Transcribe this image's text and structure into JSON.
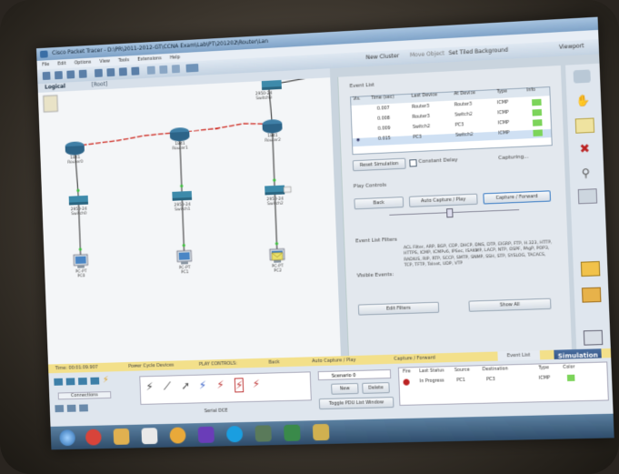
{
  "window": {
    "title": "Cisco Packet Tracer - D:\\PR\\2011-2012-GT\\CCNA Exam\\Lab\\PT\\201202\\Router\\Lan"
  },
  "menu": [
    "File",
    "Edit",
    "Options",
    "View",
    "Tools",
    "Extensions",
    "Help"
  ],
  "toolbar": {
    "new_cluster": "New Cluster",
    "move_object": "Move Object",
    "set_background": "Set Tiled Background",
    "viewport": "Viewport"
  },
  "workspace": {
    "logical_tab": "Logical",
    "root_label": "[Root]"
  },
  "devices": [
    {
      "model": "1841",
      "name": "Router0"
    },
    {
      "model": "1841",
      "name": "Router1"
    },
    {
      "model": "1841",
      "name": "Router2"
    },
    {
      "model": "2950-24",
      "name": "Switch3"
    },
    {
      "model": "2950-24",
      "name": "Switch0"
    },
    {
      "model": "2950-24",
      "name": "Switch1"
    },
    {
      "model": "2950-24",
      "name": "Switch2"
    },
    {
      "model": "PC-PT",
      "name": "PC0"
    },
    {
      "model": "PC-PT",
      "name": "PC1"
    },
    {
      "model": "PC-PT",
      "name": "PC2"
    }
  ],
  "event_list": {
    "title": "Event List",
    "headers": [
      "Vis.",
      "Time (sec)",
      "Last Device",
      "At Device",
      "Type",
      "Info"
    ],
    "rows": [
      {
        "time": "0.007",
        "last": "Router3",
        "at": "Router3",
        "type": "ICMP"
      },
      {
        "time": "0.008",
        "last": "Router3",
        "at": "Switch2",
        "type": "ICMP"
      },
      {
        "time": "0.009",
        "last": "Switch2",
        "at": "PC3",
        "type": "ICMP"
      },
      {
        "time": "0.015",
        "last": "PC3",
        "at": "Switch2",
        "type": "ICMP"
      }
    ],
    "reset_simulation": "Reset Simulation",
    "constant_delay": "Constant Delay",
    "capturing": "Capturing..."
  },
  "play_controls": {
    "title": "Play Controls",
    "back": "Back",
    "auto_capture": "Auto Capture / Play",
    "capture_forward": "Capture / Forward"
  },
  "filters": {
    "title": "Event List Filters",
    "visible_label": "Visible Events:",
    "visible_events": "ACL Filter, ARP, BGP, CDP, DHCP, DNS, DTP, EIGRP, FTP, H.323, HTTP, HTTPS, ICMP, ICMPv6, IPSec, ISAKMP, LACP, NTP, OSPF, PAgP, POP3, RADIUS, RIP, RTP, SCCP, SMTP, SNMP, SSH, STP, SYSLOG, TACACS, TCP, TFTP, Telnet, UDP, VTP",
    "edit_filters": "Edit Filters",
    "show_all": "Show All"
  },
  "status_bar": {
    "time": "Time: 00:01:09.907",
    "power_cycle": "Power Cycle Devices",
    "play_controls": "PLAY CONTROLS:",
    "back": "Back",
    "auto": "Auto Capture / Play",
    "forward": "Capture / Forward",
    "event_list": "Event List",
    "simulation": "Simulation"
  },
  "bottom": {
    "connections": "Connections",
    "cable_label": "Serial DCE",
    "scenario": "Scenario 0",
    "new": "New",
    "delete": "Delete",
    "toggle_pdu": "Toggle PDU List Window",
    "pdu_headers": [
      "Fire",
      "Last Status",
      "Source",
      "Destination",
      "Type",
      "Color"
    ],
    "pdu_row": {
      "status": "In Progress",
      "source": "PC1",
      "destination": "PC3",
      "type": "ICMP"
    }
  },
  "colors": {
    "serial_link": "#d0342c",
    "ethernet_link": "#222222",
    "pdu_green": "#7cd45a",
    "status_bar": "#f3e08a",
    "sim_badge": "#2d4d7c"
  }
}
